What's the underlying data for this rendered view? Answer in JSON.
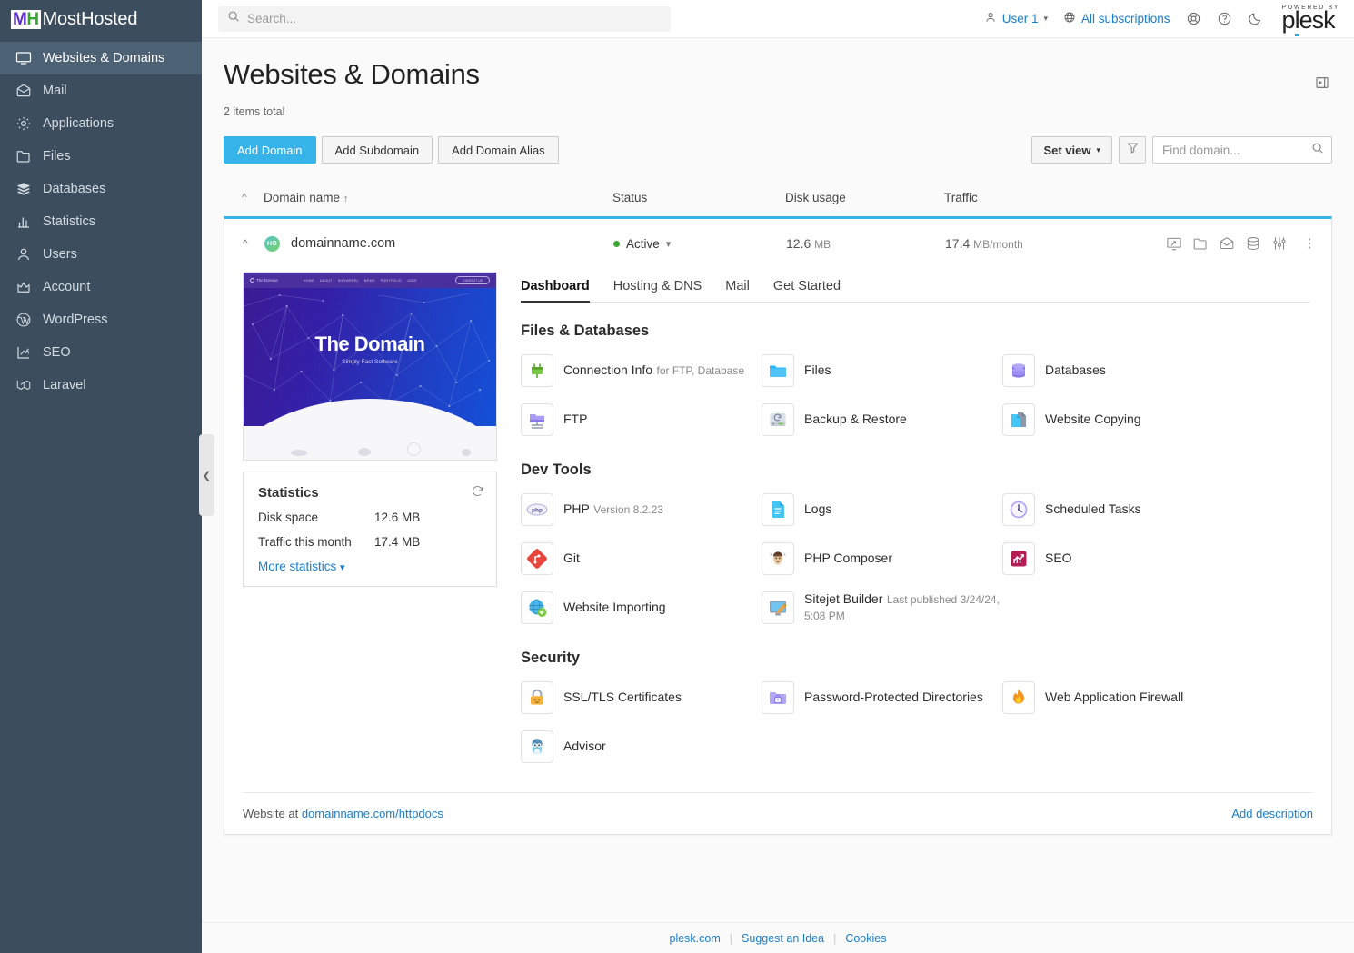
{
  "sidebar": {
    "brand": {
      "mark_a": "M",
      "mark_b": "H",
      "name": "MostHosted"
    },
    "items": [
      {
        "label": "Websites & Domains",
        "icon": "monitor-icon",
        "active": true
      },
      {
        "label": "Mail",
        "icon": "mail-icon",
        "active": false
      },
      {
        "label": "Applications",
        "icon": "gear-icon",
        "active": false
      },
      {
        "label": "Files",
        "icon": "folder-icon",
        "active": false
      },
      {
        "label": "Databases",
        "icon": "layers-icon",
        "active": false
      },
      {
        "label": "Statistics",
        "icon": "bar-chart-icon",
        "active": false
      },
      {
        "label": "Users",
        "icon": "user-icon",
        "active": false
      },
      {
        "label": "Account",
        "icon": "crown-icon",
        "active": false
      },
      {
        "label": "WordPress",
        "icon": "wordpress-icon",
        "active": false
      },
      {
        "label": "SEO",
        "icon": "seo-arrow-icon",
        "active": false
      },
      {
        "label": "Laravel",
        "icon": "laravel-icon",
        "active": false
      }
    ]
  },
  "topbar": {
    "search_placeholder": "Search...",
    "user_label": "User 1",
    "subscriptions_label": "All subscriptions",
    "plesk_powered_by": "POWERED BY",
    "plesk_name": "plesk"
  },
  "page": {
    "title": "Websites & Domains",
    "items_total": "2 items total"
  },
  "toolbar": {
    "add_domain": "Add Domain",
    "add_subdomain": "Add Subdomain",
    "add_domain_alias": "Add Domain Alias",
    "set_view": "Set view",
    "find_placeholder": "Find domain...",
    "find_value": ""
  },
  "table": {
    "headers": {
      "domain": "Domain name",
      "sort_arrow": "↑",
      "status": "Status",
      "disk": "Disk usage",
      "traffic": "Traffic"
    },
    "row": {
      "favicon_text": "HO",
      "domain": "domainname.com",
      "status": "Active",
      "disk_value": "12.6",
      "disk_unit": "MB",
      "traffic_value": "17.4",
      "traffic_unit": "MB/month"
    },
    "row_actions": [
      {
        "name": "preview-site-icon"
      },
      {
        "name": "file-manager-icon"
      },
      {
        "name": "mail-icon"
      },
      {
        "name": "databases-icon"
      },
      {
        "name": "settings-sliders-icon"
      },
      {
        "name": "more-menu-icon"
      }
    ]
  },
  "thumbnail": {
    "site_brand": "The Domain",
    "nav_links": [
      "HOME",
      "ABOUT",
      "SHOWREEL",
      "NEWS",
      "PORTFOLIO",
      "JOBS"
    ],
    "nav_button": "CONTACT US",
    "hero_title": "The Domain",
    "hero_sub": "Simply Fast Software"
  },
  "statistics": {
    "title": "Statistics",
    "rows": [
      {
        "label": "Disk space",
        "value": "12.6 MB"
      },
      {
        "label": "Traffic this month",
        "value": "17.4 MB"
      }
    ],
    "more_link": "More statistics"
  },
  "tabs": [
    {
      "label": "Dashboard",
      "active": true
    },
    {
      "label": "Hosting & DNS",
      "active": false
    },
    {
      "label": "Mail",
      "active": false
    },
    {
      "label": "Get Started",
      "active": false
    }
  ],
  "sections": [
    {
      "title": "Files & Databases",
      "tools": [
        {
          "name": "Connection Info",
          "sub": "for FTP, Database",
          "icon": "plug-icon"
        },
        {
          "name": "Files",
          "sub": "",
          "icon": "folder-blue-icon"
        },
        {
          "name": "Databases",
          "sub": "",
          "icon": "database-purple-icon"
        },
        {
          "name": "FTP",
          "sub": "",
          "icon": "ftp-server-icon"
        },
        {
          "name": "Backup & Restore",
          "sub": "",
          "icon": "backup-disk-icon"
        },
        {
          "name": "Website Copying",
          "sub": "",
          "icon": "copy-pages-icon"
        }
      ]
    },
    {
      "title": "Dev Tools",
      "tools": [
        {
          "name": "PHP",
          "sub": "Version 8.2.23",
          "icon": "php-icon"
        },
        {
          "name": "Logs",
          "sub": "",
          "icon": "logs-document-icon"
        },
        {
          "name": "Scheduled Tasks",
          "sub": "",
          "icon": "clock-icon"
        },
        {
          "name": "Git",
          "sub": "",
          "icon": "git-icon"
        },
        {
          "name": "PHP Composer",
          "sub": "",
          "icon": "composer-icon"
        },
        {
          "name": "SEO",
          "sub": "",
          "icon": "seo-chart-icon"
        },
        {
          "name": "Website Importing",
          "sub": "",
          "icon": "globe-import-icon"
        },
        {
          "name": "Sitejet Builder",
          "sub": "Last published 3/24/24, 5:08 PM",
          "icon": "sitejet-icon"
        }
      ]
    },
    {
      "title": "Security",
      "tools": [
        {
          "name": "SSL/TLS Certificates",
          "sub": "",
          "icon": "lock-icon"
        },
        {
          "name": "Password-Protected Directories",
          "sub": "",
          "icon": "locked-folder-icon"
        },
        {
          "name": "Web Application Firewall",
          "sub": "",
          "icon": "flame-icon"
        },
        {
          "name": "Advisor",
          "sub": "",
          "icon": "advisor-owl-icon"
        }
      ]
    }
  ],
  "card_footer": {
    "prefix": "Website at",
    "link": "domainname.com/httpdocs",
    "add_description": "Add description"
  },
  "page_footer": {
    "links": [
      "plesk.com",
      "Suggest an Idea",
      "Cookies"
    ]
  },
  "colors": {
    "accent": "#36b3e8",
    "link": "#1a7ec8",
    "sidebar": "#3c4d5d",
    "status_active": "#3aa832"
  }
}
